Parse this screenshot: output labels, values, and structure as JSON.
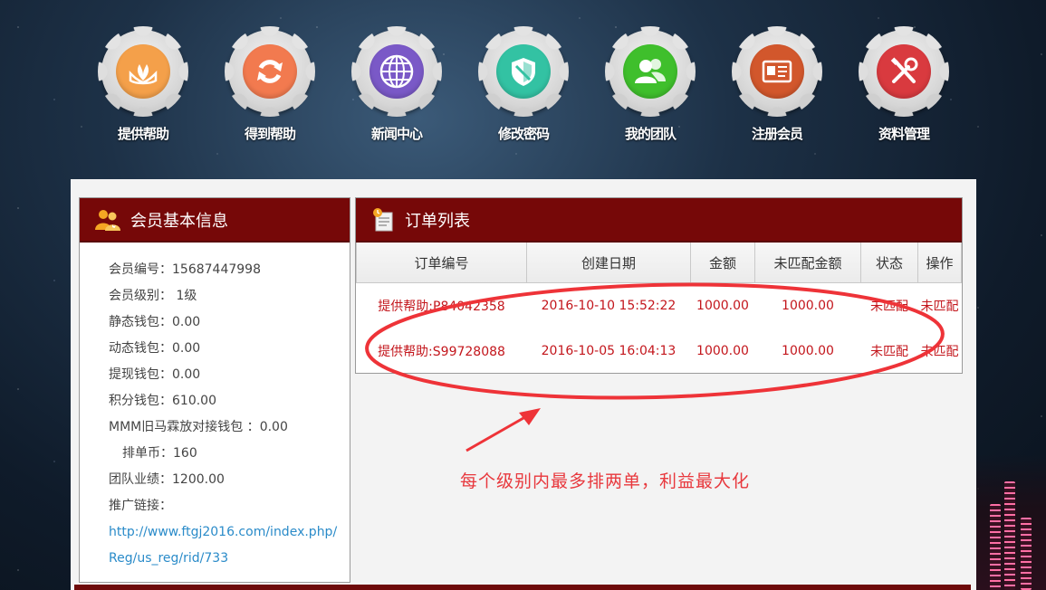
{
  "nav": [
    {
      "label": "提供帮助",
      "icon": "hand-plant-icon",
      "color": "#f4a04a"
    },
    {
      "label": "得到帮助",
      "icon": "refresh-icon",
      "color": "#f27a4f"
    },
    {
      "label": "新闻中心",
      "icon": "globe-icon",
      "color": "#7a59c7"
    },
    {
      "label": "修改密码",
      "icon": "shield-icon",
      "color": "#33c2a3"
    },
    {
      "label": "我的团队",
      "icon": "team-icon",
      "color": "#3fbf2c"
    },
    {
      "label": "注册会员",
      "icon": "id-card-icon",
      "color": "#d2572c"
    },
    {
      "label": "资料管理",
      "icon": "tools-icon",
      "color": "#d93a3f"
    }
  ],
  "member": {
    "title": "会员基本信息",
    "fields": [
      {
        "label": "会员编号：",
        "value": "15687447998"
      },
      {
        "label": "会员级别：",
        "value": " 1级"
      },
      {
        "label": "静态钱包：",
        "value": "0.00"
      },
      {
        "label": "动态钱包：",
        "value": "0.00"
      },
      {
        "label": "提现钱包：",
        "value": "0.00"
      },
      {
        "label": "积分钱包：",
        "value": "610.00"
      },
      {
        "label": "MMM旧马霖放对接钱包 ：",
        "value": "0.00"
      },
      {
        "label": "排单币：",
        "value": "160"
      },
      {
        "label": "团队业绩：",
        "value": "1200.00"
      },
      {
        "label": "推广链接：",
        "value": ""
      }
    ],
    "link_line1": "http://www.ftgj2016.com/index.php/",
    "link_line2": "Reg/us_reg/rid/733"
  },
  "orders": {
    "title": "订单列表",
    "columns": [
      "订单编号",
      "创建日期",
      "金额",
      "未匹配金额",
      "状态",
      "操作"
    ],
    "rows": [
      [
        "提供帮助:P84042358",
        "2016-10-10 15:52:22",
        "1000.00",
        "1000.00",
        "未匹配",
        "未匹配"
      ],
      [
        "提供帮助:S99728088",
        "2016-10-05 16:04:13",
        "1000.00",
        "1000.00",
        "未匹配",
        "未匹配"
      ]
    ]
  },
  "annotation": {
    "text": "每个级别内最多排两单，利益最大化",
    "color": "#e8383d"
  },
  "colors": {
    "header_red": "#760808",
    "order_text": "#c3161c",
    "link_blue": "#2a8bc9"
  }
}
